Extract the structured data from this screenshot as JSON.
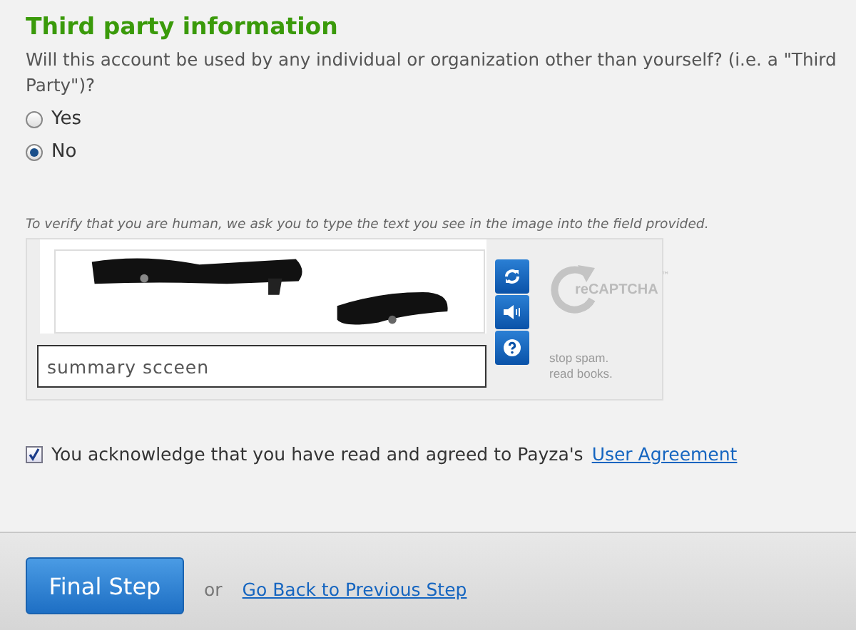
{
  "section": {
    "title": "Third party information",
    "question": "Will this account be used by any individual or organization other than yourself? (i.e. a \"Third Party\")?",
    "options": [
      {
        "label": "Yes",
        "selected": false
      },
      {
        "label": "No",
        "selected": true
      }
    ]
  },
  "captcha": {
    "instructions": "To verify that you are human, we ask you to type the text you see in the image into the field provided.",
    "answer": "summary scceen",
    "logo": "reCAPTCHA",
    "trademark": "™",
    "tagline_lines": [
      "stop spam.",
      "read books."
    ]
  },
  "agreement": {
    "checked": true,
    "text": "You acknowledge that you have read and agreed to Payza's",
    "link": "User Agreement"
  },
  "footer": {
    "primary_button": "Final Step",
    "separator": "or",
    "back_link": "Go Back to Previous Step"
  }
}
